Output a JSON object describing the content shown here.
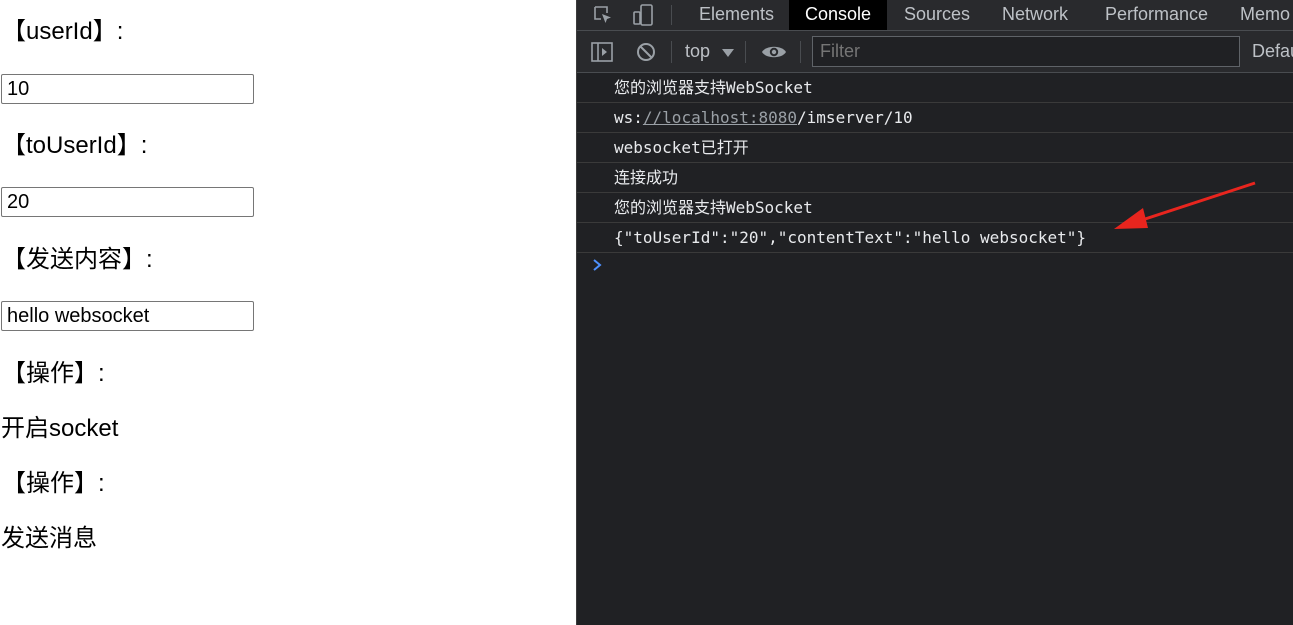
{
  "page": {
    "userid_label": "【userId】:",
    "userid_value": "10",
    "touserid_label": "【toUserId】:",
    "touserid_value": "20",
    "content_label": "【发送内容】:",
    "content_value": "hello websocket",
    "op1_label": "【操作】:",
    "open_socket": "开启socket",
    "op2_label": "【操作】:",
    "send_message": "发送消息"
  },
  "devtools": {
    "tabs": [
      "Elements",
      "Console",
      "Sources",
      "Network",
      "Performance",
      "Memo"
    ],
    "active_tab": "Console",
    "context": "top",
    "filter_placeholder": "Filter",
    "levels_label": "Defau",
    "messages": [
      "您的浏览器支持WebSocket",
      "ws:",
      "//localhost:8080",
      "/imserver/10",
      "websocket已打开",
      "连接成功",
      "您的浏览器支持WebSocket",
      "{\"toUserId\":\"20\",\"contentText\":\"hello websocket\"}"
    ],
    "colors": {
      "panel_bg": "#202124",
      "toolbar_bg": "#292a2d",
      "text": "#e8eaed",
      "prompt": "#4d90fe",
      "annotation_arrow": "#e8251e"
    }
  },
  "icons": [
    "inspect-element-icon",
    "device-toolbar-icon",
    "sidebar-toggle-icon",
    "clear-console-icon",
    "dropdown-triangle-icon",
    "eye-icon",
    "console-prompt-icon",
    "annotation-arrow"
  ]
}
